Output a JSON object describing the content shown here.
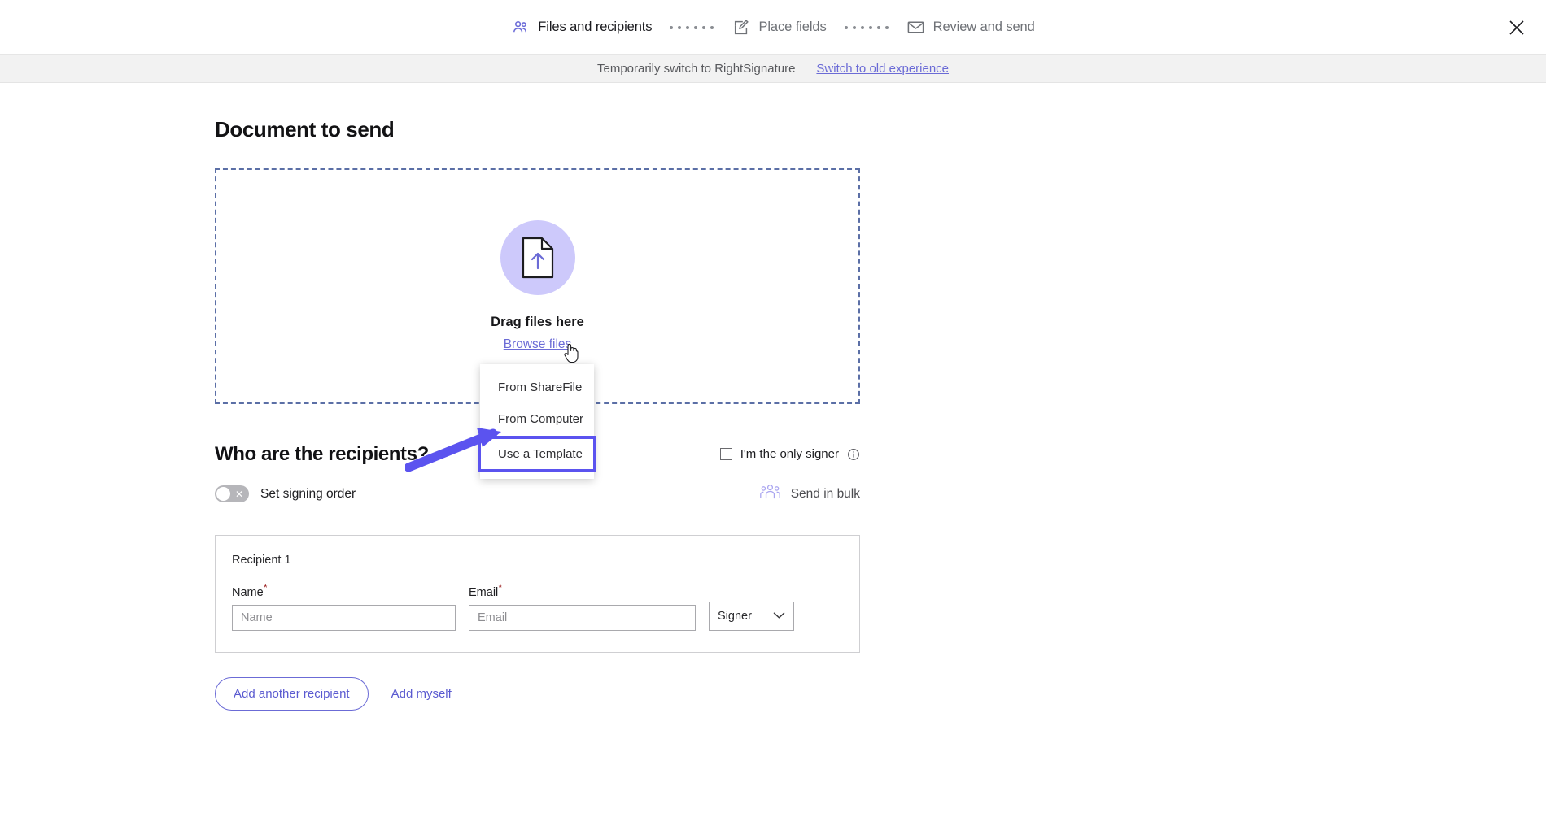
{
  "topbar": {
    "steps": [
      {
        "label": "Files and recipients",
        "icon": "people-icon",
        "active": true
      },
      {
        "label": "Place fields",
        "icon": "pencil-square-icon",
        "active": false
      },
      {
        "label": "Review and send",
        "icon": "envelope-icon",
        "active": false
      }
    ],
    "separator_dot_count": 6,
    "close_label": "close-icon"
  },
  "notice": {
    "text": "Temporarily switch to RightSignature",
    "link": "Switch to old experience"
  },
  "main": {
    "page_title": "Document to send",
    "dropzone": {
      "drag_text": "Drag files here",
      "browse_link": "Browse files",
      "upload_icon": "file-upload-icon"
    },
    "menu": {
      "items": [
        {
          "label": "From ShareFile",
          "highlighted": false
        },
        {
          "label": "From Computer",
          "highlighted": false
        },
        {
          "label": "Use a Template",
          "highlighted": true
        }
      ]
    },
    "recipients": {
      "section_title": "Who are the recipients?",
      "only_signer_label": "I'm the only signer",
      "only_signer_checked": false,
      "info_icon": "info-icon",
      "signing_order_label": "Set signing order",
      "signing_order_enabled": false,
      "bulk_label": "Send in bulk",
      "bulk_icon": "group-people-icon",
      "card": {
        "title": "Recipient 1",
        "name_label": "Name",
        "name_required": "*",
        "name_placeholder": "Name",
        "name_value": "",
        "email_label": "Email",
        "email_required": "*",
        "email_placeholder": "Email",
        "email_value": "",
        "role_value": "Signer"
      },
      "add_recipient_label": "Add another recipient",
      "add_myself_label": "Add myself"
    }
  },
  "colors": {
    "accent_purple": "#5b53ef",
    "link_purple": "#6b6bd6",
    "upload_circle": "#cdc9fb",
    "dropzone_border": "#5b6fa6",
    "required_red": "#9b2020"
  }
}
